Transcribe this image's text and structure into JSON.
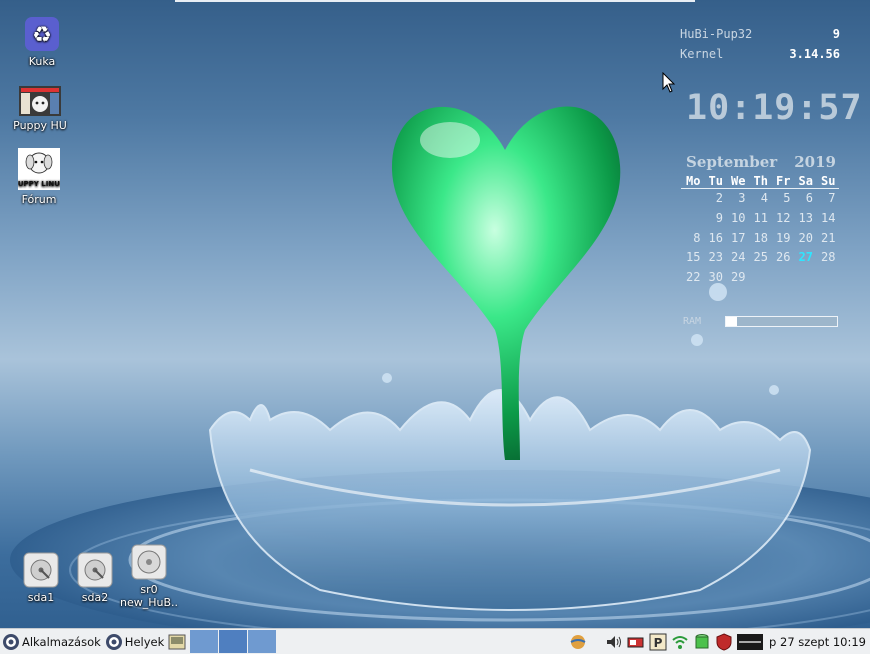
{
  "desktop": {
    "icons": [
      {
        "label": "Kuka"
      },
      {
        "label": "Puppy HU"
      },
      {
        "label": "Fórum"
      }
    ],
    "drives": [
      {
        "label": "sda1"
      },
      {
        "label": "sda2"
      },
      {
        "label": "sr0",
        "sublabel": "new_HuB.."
      }
    ],
    "forum_logo_text": "PUPPY LINUX"
  },
  "conky": {
    "distro_key": "HuBi-Pup32",
    "distro_val": "9",
    "kernel_key": "Kernel",
    "kernel_val": "3.14.56",
    "time": "10:19:57",
    "cal_month": "September",
    "cal_year": "2019",
    "weekdays": [
      "Mo",
      "Tu",
      "We",
      "Th",
      "Fr",
      "Sa",
      "Su"
    ],
    "weeks": [
      [
        "",
        "2",
        "3",
        "4",
        "5",
        "6",
        "7"
      ],
      [
        "",
        "9",
        "10",
        "11",
        "12",
        "13",
        "14"
      ],
      [
        "8",
        "16",
        "17",
        "18",
        "19",
        "20",
        "21"
      ],
      [
        "15",
        "23",
        "24",
        "25",
        "26",
        "27",
        "28"
      ],
      [
        "22",
        "30",
        "29",
        "",
        "",
        "",
        ""
      ]
    ],
    "today": "27",
    "ram_label": "RAM",
    "ram_fraction": 0.1
  },
  "taskbar": {
    "apps_label": "Alkalmazások",
    "places_label": "Helyek",
    "datetime": "p 27 szept 10:19"
  },
  "colors": {
    "today": "#2ee6ff",
    "heart": "#1fd46a",
    "taskbar": "#eef0f2"
  }
}
